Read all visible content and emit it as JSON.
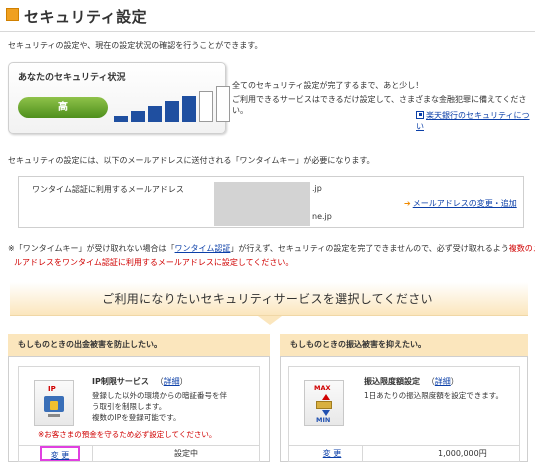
{
  "page": {
    "title": "セキュリティ設定",
    "intro": "セキュリティの設定や、現在の設定状況の確認を行うことができます。"
  },
  "status_card": {
    "title": "あなたのセキュリティ状況",
    "level_label": "高",
    "level_filled": 5,
    "level_total": 7,
    "colors": {
      "filled_bar": "#1f4fa0",
      "empty_bar": "#ffffff",
      "pill": "#5a9a23"
    }
  },
  "status_message": {
    "line1": "全てのセキュリティ設定が完了するまで、あと少し！",
    "line2": "ご利用できるサービスはできるだけ設定して、さまざまな金融犯罪に備えてください。",
    "link": "楽天銀行のセキュリティについ"
  },
  "otk_description": "セキュリティの設定には、以下のメールアドレスに送付される「ワンタイムキー」が必要になります。",
  "email_section": {
    "label": "ワンタイム認証に利用するメールアドレス",
    "domain1": ".jp",
    "domain2": "ne.jp",
    "change_link": "メールアドレスの変更・追加"
  },
  "notes": {
    "line1_pre": "※「ワンタイムキー」が受け取れない場合は「",
    "line1_link": "ワンタイム認証",
    "line1_post": "」が行えず、セキュリティの設定を完了できませんので、必ず受け取れるよう",
    "line1_red": "複数のメ",
    "line2": "ルアドレスをワンタイム認証に利用するメールアドレスに設定してください。"
  },
  "select_banner": "ご利用になりたいセキュリティサービスを選択してください",
  "services": [
    {
      "header": "もしものときの出金被害を防止したい。",
      "icon_label": "IP",
      "title": "IP制限サービス",
      "detail_link": "詳細",
      "desc_lines": [
        "登録した以外の環境からの暗証番号を伴",
        "う取引を制限します。",
        "複数のIPを登録可能です。"
      ],
      "warning": "※お客さまの預金を守るため必ず設定してください。",
      "action": "変 更",
      "value": "設定中"
    },
    {
      "header": "もしものときの振込被害を抑えたい。",
      "icon_label_top": "MAX",
      "icon_label_bottom": "MIN",
      "title": "振込限度額設定",
      "detail_link": "詳細",
      "desc_lines": [
        "1日あたりの振込限度額を設定できます。"
      ],
      "action": "変 更",
      "value": "1,000,000円"
    }
  ]
}
